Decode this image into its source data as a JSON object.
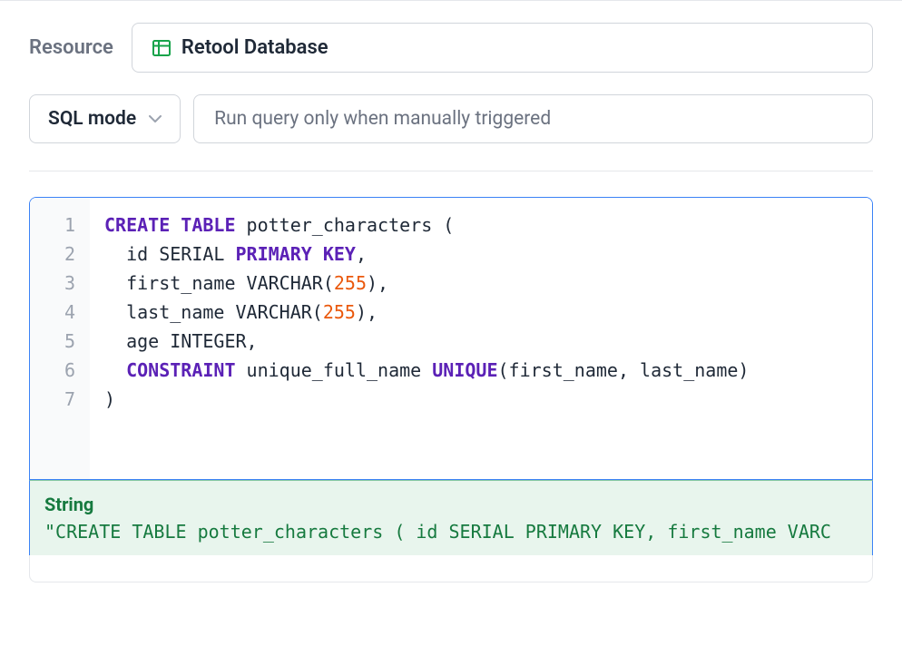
{
  "resource": {
    "label": "Resource",
    "selected": "Retool Database"
  },
  "mode": {
    "label": "SQL mode"
  },
  "trigger": {
    "label": "Run query only when manually triggered"
  },
  "editor": {
    "lines": [
      "1",
      "2",
      "3",
      "4",
      "5",
      "6",
      "7"
    ],
    "code": {
      "line1_kw1": "CREATE",
      "line1_kw2": "TABLE",
      "line1_rest": " potter_characters (",
      "line2_pre": "  id SERIAL ",
      "line2_kw1": "PRIMARY",
      "line2_kw2": "KEY",
      "line2_rest": ",",
      "line3_pre": "  first_name VARCHAR(",
      "line3_num": "255",
      "line3_rest": "),",
      "line4_pre": "  last_name VARCHAR(",
      "line4_num": "255",
      "line4_rest": "),",
      "line5": "  age INTEGER,",
      "line6_pre": "  ",
      "line6_kw1": "CONSTRAINT",
      "line6_mid": " unique_full_name ",
      "line6_kw2": "UNIQUE",
      "line6_rest": "(first_name, last_name)",
      "line7": ")"
    }
  },
  "result": {
    "type": "String",
    "value": "\"CREATE TABLE potter_characters ( id SERIAL PRIMARY KEY, first_name VARC"
  }
}
